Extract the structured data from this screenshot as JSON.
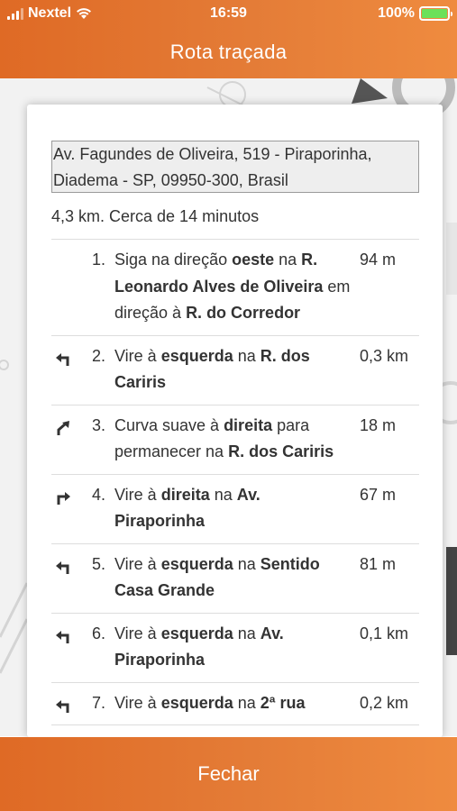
{
  "status_bar": {
    "carrier": "Nextel",
    "time": "16:59",
    "battery": "100%"
  },
  "header": {
    "title": "Rota traçada"
  },
  "route": {
    "address": "Av. Fagundes de Oliveira, 519 - Piraporinha, Diadema - SP, 09950-300, Brasil",
    "summary": "4,3 km. Cerca de 14 minutos",
    "steps": [
      {
        "number": "1.",
        "icon": "none",
        "distance": "94 m",
        "parts": [
          [
            "Siga na direção ",
            false
          ],
          [
            "oeste",
            true
          ],
          [
            " na ",
            false
          ],
          [
            "R. Leonardo Alves de Oliveira",
            true
          ],
          [
            " em direção à ",
            false
          ],
          [
            "R. do Corredor",
            true
          ]
        ]
      },
      {
        "number": "2.",
        "icon": "turn-left-icon",
        "distance": "0,3 km",
        "parts": [
          [
            "Vire à ",
            false
          ],
          [
            "esquerda",
            true
          ],
          [
            " na ",
            false
          ],
          [
            "R. dos Cariris",
            true
          ]
        ]
      },
      {
        "number": "3.",
        "icon": "slight-right-icon",
        "distance": "18 m",
        "parts": [
          [
            "Curva suave à ",
            false
          ],
          [
            "direita",
            true
          ],
          [
            " para permanecer na ",
            false
          ],
          [
            "R. dos Cariris",
            true
          ]
        ]
      },
      {
        "number": "4.",
        "icon": "turn-right-icon",
        "distance": "67 m",
        "parts": [
          [
            "Vire à ",
            false
          ],
          [
            "direita",
            true
          ],
          [
            " na ",
            false
          ],
          [
            "Av. Piraporinha",
            true
          ]
        ]
      },
      {
        "number": "5.",
        "icon": "turn-left-icon",
        "distance": "81 m",
        "parts": [
          [
            "Vire à ",
            false
          ],
          [
            "esquerda",
            true
          ],
          [
            " na ",
            false
          ],
          [
            "Sentido Casa Grande",
            true
          ]
        ]
      },
      {
        "number": "6.",
        "icon": "turn-left-icon",
        "distance": "0,1 km",
        "parts": [
          [
            "Vire à ",
            false
          ],
          [
            "esquerda",
            true
          ],
          [
            " na ",
            false
          ],
          [
            "Av. Piraporinha",
            true
          ]
        ]
      },
      {
        "number": "7.",
        "icon": "turn-left-icon",
        "distance": "0,2 km",
        "parts": [
          [
            "Vire à ",
            false
          ],
          [
            "esquerda",
            true
          ],
          [
            " na ",
            false
          ],
          [
            "2ª rua",
            true
          ]
        ]
      }
    ]
  },
  "footer": {
    "close_label": "Fechar"
  },
  "colors": {
    "accent": "#e47c37",
    "battery": "#6be15a"
  }
}
